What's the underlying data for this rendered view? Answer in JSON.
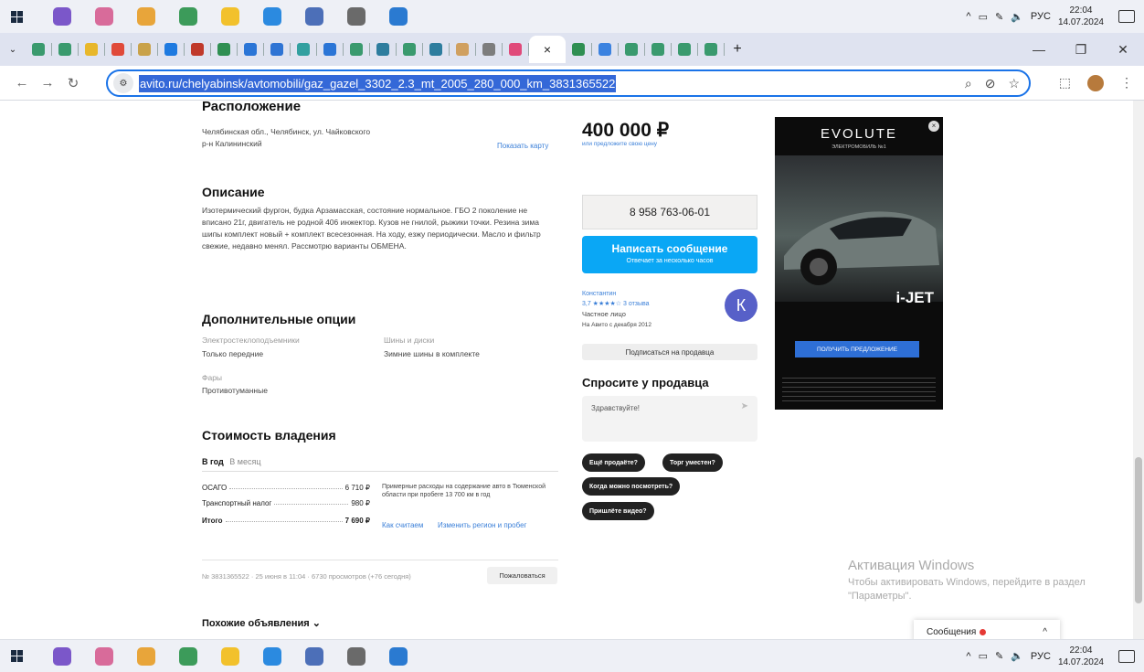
{
  "taskbar": {
    "lang": "РУС",
    "time": "22:04",
    "date": "14.07.2024",
    "apps": [
      {
        "name": "viber-icon",
        "color": "#7b57c9"
      },
      {
        "name": "network-icon",
        "color": "#d86b9a"
      },
      {
        "name": "chrome-icon",
        "color": "#e8a53a"
      },
      {
        "name": "excel-icon",
        "color": "#3c9b5a"
      },
      {
        "name": "files-icon",
        "color": "#f2c12c"
      },
      {
        "name": "telegram-icon",
        "color": "#2b8ae0"
      },
      {
        "name": "notes-icon",
        "color": "#4c6fb8"
      },
      {
        "name": "settings-icon",
        "color": "#6a6a6a"
      },
      {
        "name": "remote-icon",
        "color": "#2a7ad1"
      }
    ]
  },
  "browser": {
    "url": "avito.ru/chelyabinsk/avtomobili/gaz_gazel_3302_2.3_mt_2005_280_000_km_3831365522",
    "active_tab_close": "×",
    "new_tab": "+",
    "tab_icon_colors": [
      "#3a9a6e",
      "#3a9a6e",
      "#e8b72a",
      "#e04a3a",
      "#c9a24a",
      "#1f7ae0",
      "#c0392b",
      "#2f8f52",
      "#2b75d6",
      "#2f74d4",
      "#32a0a0",
      "#2b75d6",
      "#3a9a6e",
      "#2e7d9e",
      "#3a9a6e",
      "#2e7d9e",
      "#d0a060",
      "#7d7d7d",
      "#e04a7a",
      "#2f8f52",
      "#3b82e0",
      "#3a9a6e",
      "#3a9a6e",
      "#3a9a6e",
      "#3a9a6e"
    ]
  },
  "listing": {
    "location_title": "Расположение",
    "address_line1": "Челябинская обл., Челябинск, ул. Чайковского",
    "address_line2": "р-н Калининский",
    "show_map": "Показать карту",
    "description_title": "Описание",
    "description": "Изотермический фургон, будка Арзамасская, состояние нормальное. ГБО 2 поколение не вписано 21г, двигатель не родной 406 инжектор. Кузов не гнилой, рыжики точки. Резина зима шипы комплект новый + комплект всесезонная. На ходу, езжу периодически. Масло и фильтр свежие, недавно менял. Рассмотрю варианты ОБМЕНА.",
    "options_title": "Дополнительные опции",
    "opt_power_label": "Электростеклоподъемники",
    "opt_power_value": "Только передние",
    "opt_tires_label": "Шины и диски",
    "opt_tires_value": "Зимние шины в комплекте",
    "opt_lights_label": "Фары",
    "opt_lights_value": "Противотуманные",
    "cost_title": "Стоимость владения",
    "tab_year": "В год",
    "tab_month": "В месяц",
    "cost_osago_label": "ОСАГО",
    "cost_osago_value": "6 710 ₽",
    "cost_tax_label": "Транспортный налог",
    "cost_tax_value": "980 ₽",
    "cost_total_label": "Итого",
    "cost_total_value": "7 690 ₽",
    "cost_note": "Примерные расходы на содержание авто в Тюменской области при пробеге 13 700 км в год",
    "how_calc": "Как считаем",
    "change_region": "Изменить регион и пробег",
    "meta": "№ 3831365522 · 25 июня в 11:04 · 6730 просмотров (+76 сегодня)",
    "complain": "Пожаловаться",
    "similar": "Похожие объявления ⌄"
  },
  "sidebar": {
    "price": "400 000 ₽",
    "price_sub": "или предложите свою цену",
    "phone": "8 958 763-06-01",
    "write_btn": "Написать сообщение",
    "write_sub": "Отвечает за несколько часов",
    "seller_name": "Константин",
    "rating": "3,7 ★★★★☆ 3 отзыва",
    "seller_type": "Частное лицо",
    "since": "На Авито с декабря 2012",
    "avatar_letter": "К",
    "subscribe": "Подписаться на продавца",
    "ask_title": "Спросите у продавца",
    "ask_placeholder": "Здравствуйте!",
    "send_icon": "➤",
    "chip1": "Ещё продаёте?",
    "chip2": "Торг уместен?",
    "chip3": "Когда можно посмотреть?",
    "chip4": "Пришлёте видео?"
  },
  "ad": {
    "brand": "EVOLUTE",
    "sub": "ЭЛЕКТРОМОБИЛЬ №1",
    "model": "i-JET",
    "cta": "ПОЛУЧИТЬ ПРЕДЛОЖЕНИЕ"
  },
  "activation": {
    "title": "Активация Windows",
    "text": "Чтобы активировать Windows, перейдите в раздел \"Параметры\"."
  },
  "messages_pill": "Сообщения"
}
